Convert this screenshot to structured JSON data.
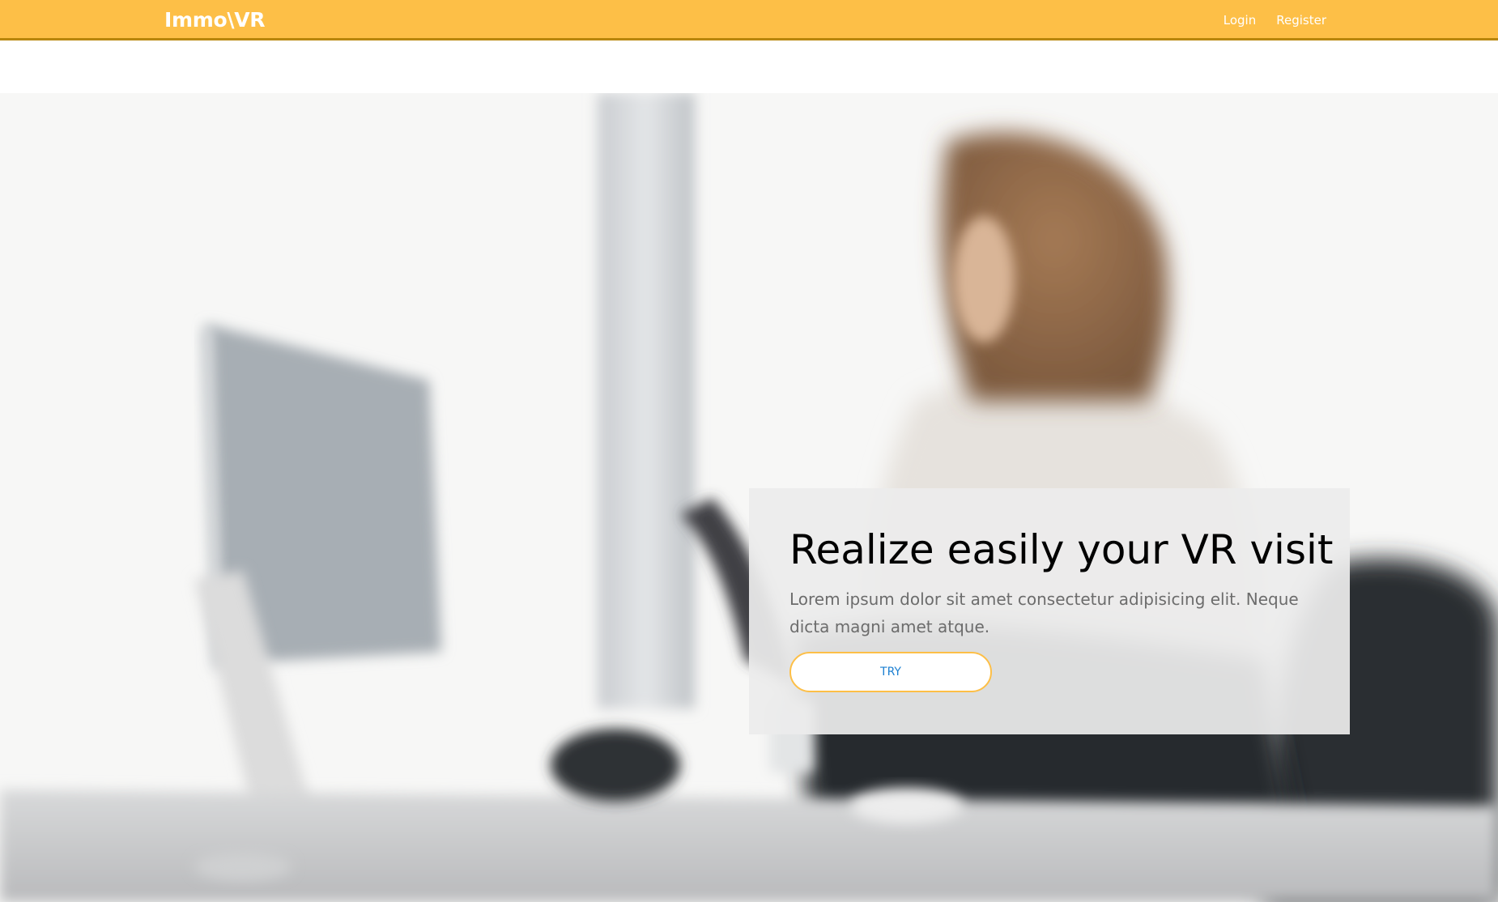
{
  "navbar": {
    "brand": "Immo\\VR",
    "links": [
      {
        "label": "Login"
      },
      {
        "label": "Register"
      }
    ],
    "color": "#fdbf47",
    "border_color": "#b8860b"
  },
  "hero": {
    "background": "blurred photo of a woman working at a desktop computer in a bright office",
    "card": {
      "title": "Realize easily your VR visit",
      "text": "Lorem ipsum dolor sit amet consectetur adipisicing elit. Neque dicta magni amet atque.",
      "button_label": "TRY",
      "button_border_color": "#fdbf47",
      "button_text_color": "#1b7fd1"
    }
  }
}
